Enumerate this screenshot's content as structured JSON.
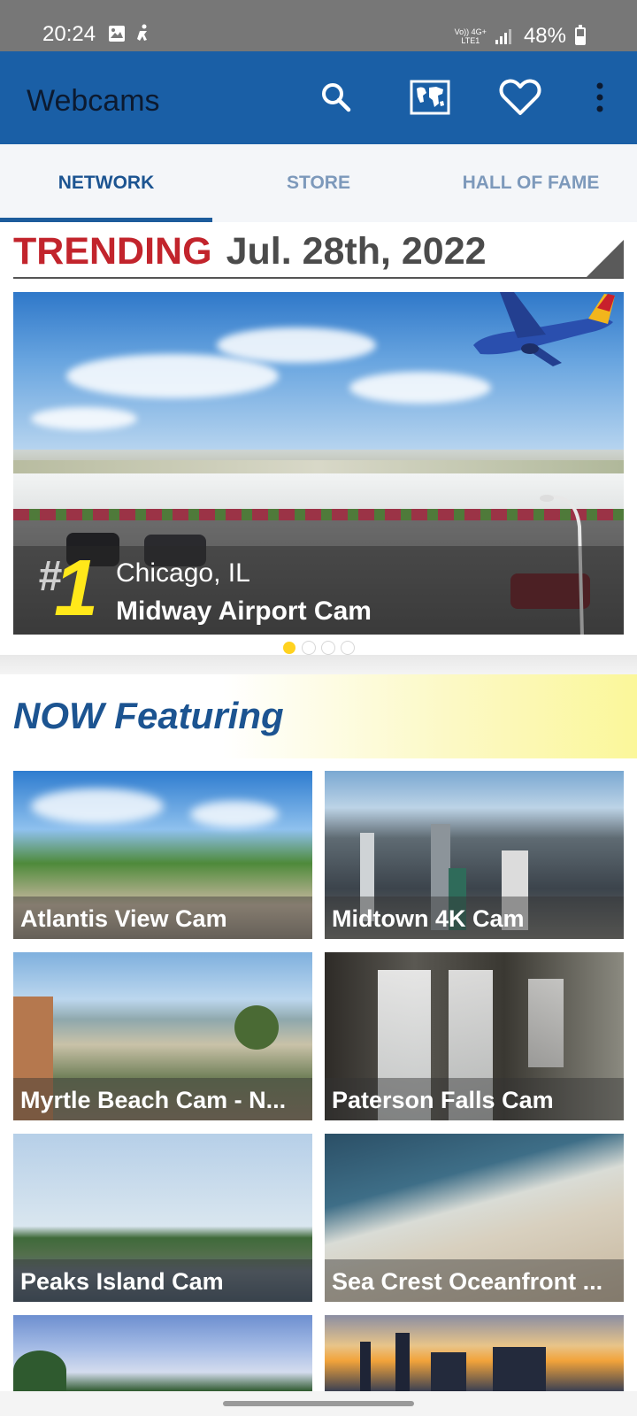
{
  "status_bar": {
    "time": "20:24",
    "network_label_top": "Vo)) 4G+",
    "network_label_bottom": "LTE1",
    "battery": "48%",
    "icons": [
      "image-icon",
      "accessibility-icon",
      "signal-icon",
      "battery-icon"
    ]
  },
  "app_bar": {
    "title": "Webcams",
    "actions": [
      "search-icon",
      "world-map-icon",
      "heart-icon",
      "more-vert-icon"
    ],
    "color": "#1a5fa6"
  },
  "tabs": [
    {
      "label": "NETWORK",
      "active": true
    },
    {
      "label": "STORE",
      "active": false
    },
    {
      "label": "HALL OF FAME",
      "active": false
    }
  ],
  "trending": {
    "label": "TRENDING",
    "date": "Jul. 28th, 2022",
    "rank_hash": "#",
    "rank": "1",
    "city": "Chicago, IL",
    "cam_name": "Midway Airport Cam",
    "carousel_count": 4,
    "carousel_active": 1
  },
  "featuring": {
    "title": "NOW Featuring",
    "cams": [
      {
        "label": "Atlantis View Cam"
      },
      {
        "label": "Midtown 4K Cam"
      },
      {
        "label": "Myrtle Beach Cam - N..."
      },
      {
        "label": "Paterson Falls Cam"
      },
      {
        "label": "Peaks Island Cam"
      },
      {
        "label": "Sea Crest Oceanfront ..."
      },
      {
        "label": ""
      },
      {
        "label": ""
      }
    ]
  }
}
